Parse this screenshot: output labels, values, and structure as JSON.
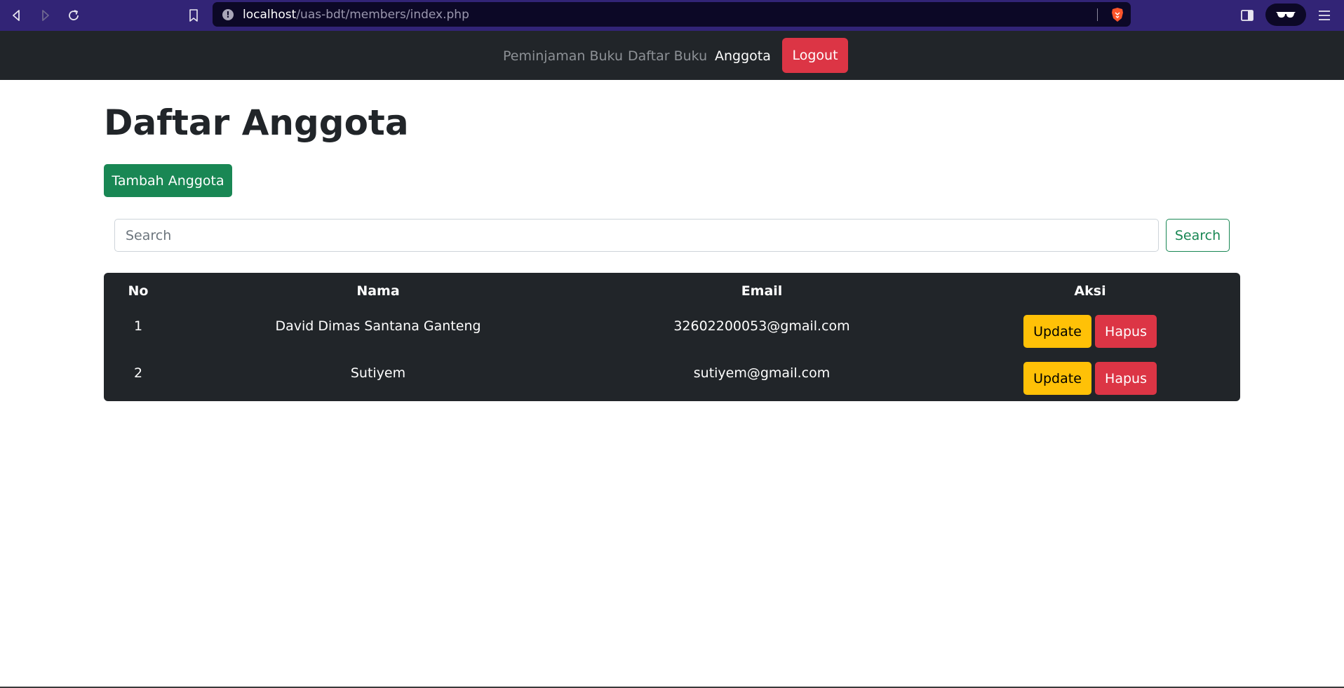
{
  "browser": {
    "url_host": "localhost",
    "url_path": "/uas-bdt/members/index.php",
    "icons": [
      "back-icon",
      "forward-icon",
      "reload-icon",
      "bookmark-icon",
      "site-info-icon",
      "brave-shield-icon",
      "sidebar-icon",
      "vpn-glasses-icon",
      "menu-icon"
    ]
  },
  "navbar": {
    "links": [
      {
        "label": "Peminjaman Buku",
        "active": false
      },
      {
        "label": "Daftar Buku",
        "active": false
      },
      {
        "label": "Anggota",
        "active": true
      }
    ],
    "logout_label": "Logout"
  },
  "main": {
    "title": "Daftar Anggota",
    "add_button_label": "Tambah Anggota",
    "search": {
      "placeholder": "Search",
      "value": "",
      "button_label": "Search"
    }
  },
  "table": {
    "headers": [
      "No",
      "Nama",
      "Email",
      "Aksi"
    ],
    "rows": [
      {
        "no": "1",
        "nama": "David Dimas Santana Ganteng",
        "email": "32602200053@gmail.com",
        "update_label": "Update",
        "delete_label": "Hapus"
      },
      {
        "no": "2",
        "nama": "Sutiyem",
        "email": "sutiyem@gmail.com",
        "update_label": "Update",
        "delete_label": "Hapus"
      }
    ]
  },
  "colors": {
    "browser_bar": "#322476",
    "navbar": "#212529",
    "danger": "#dc3545",
    "success": "#198754",
    "warning": "#ffc107"
  }
}
